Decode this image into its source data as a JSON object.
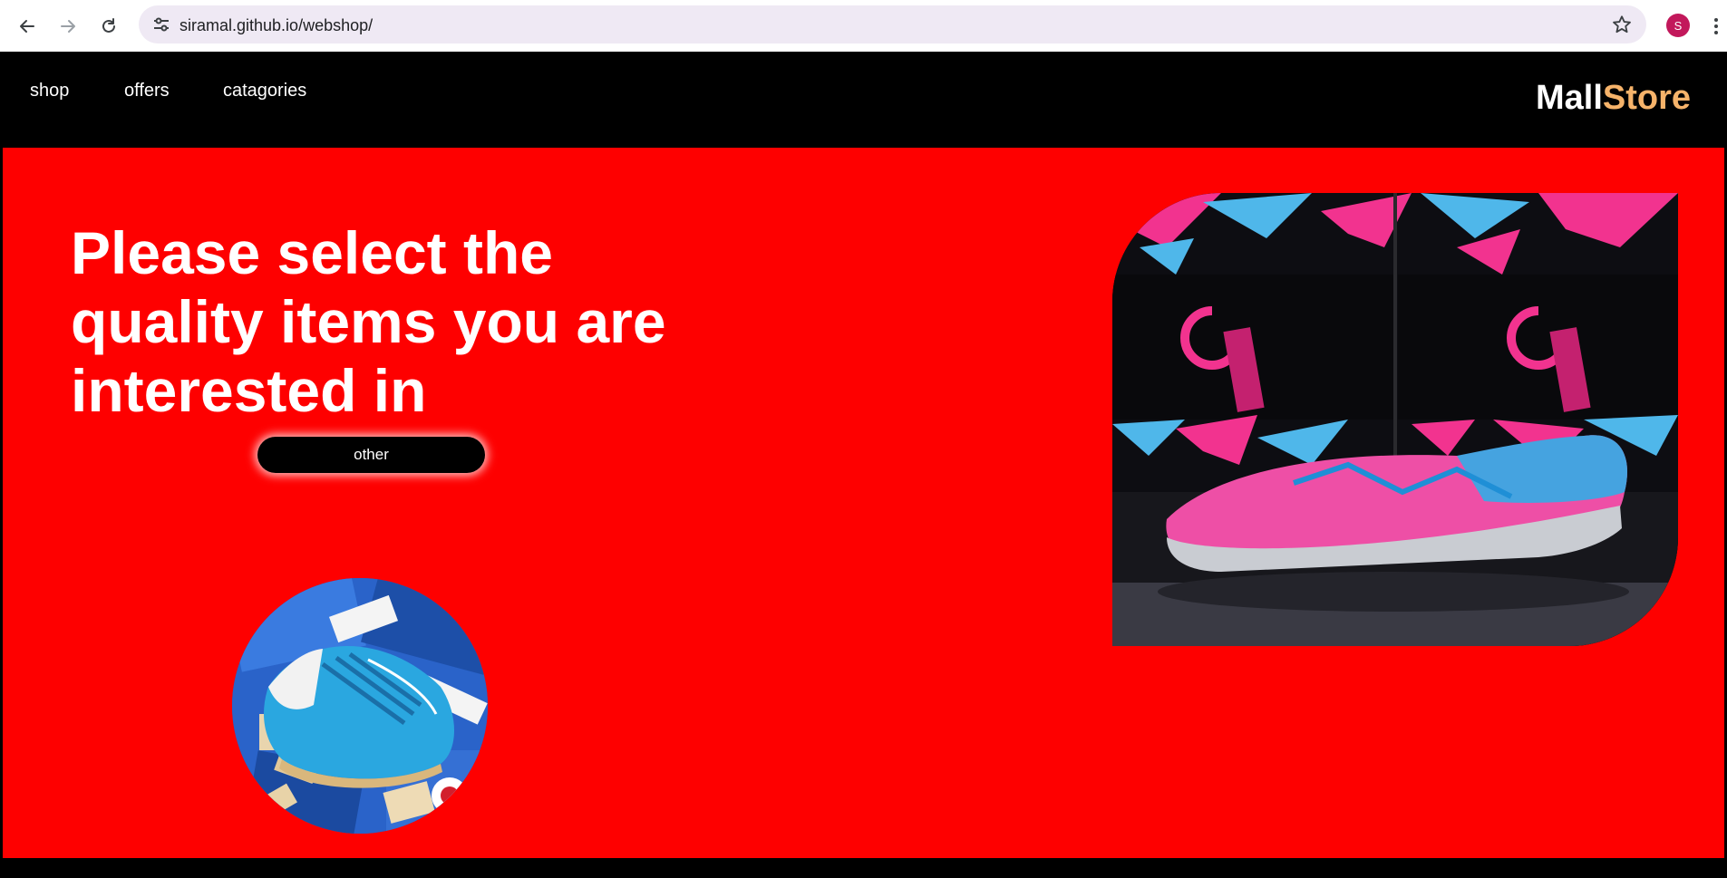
{
  "browser": {
    "url": "siramal.github.io/webshop/",
    "profile_initial": "S",
    "icons": {
      "back": "back-arrow-icon",
      "forward": "forward-arrow-icon",
      "reload": "reload-icon",
      "site_info": "site-settings-icon",
      "bookmark": "star-icon",
      "menu": "kebab-menu-icon"
    }
  },
  "header": {
    "nav": [
      "shop",
      "offers",
      "catagories"
    ],
    "logo_part1": "Mall",
    "logo_part2": "Store"
  },
  "hero": {
    "headline": "Please select the quality items you are interested in",
    "button_label": "other",
    "images": {
      "circle": "blue-football-boot-photo",
      "banner": "pink-futsal-shoe-photo"
    }
  },
  "colors": {
    "hero_bg": "#fe0000",
    "header_bg": "#000000",
    "logo_white": "#ffffff",
    "logo_accent": "#f6b36a",
    "button_bg": "#000000",
    "omnibox_bg": "#efe9f4",
    "avatar_bg": "#c2185b"
  }
}
